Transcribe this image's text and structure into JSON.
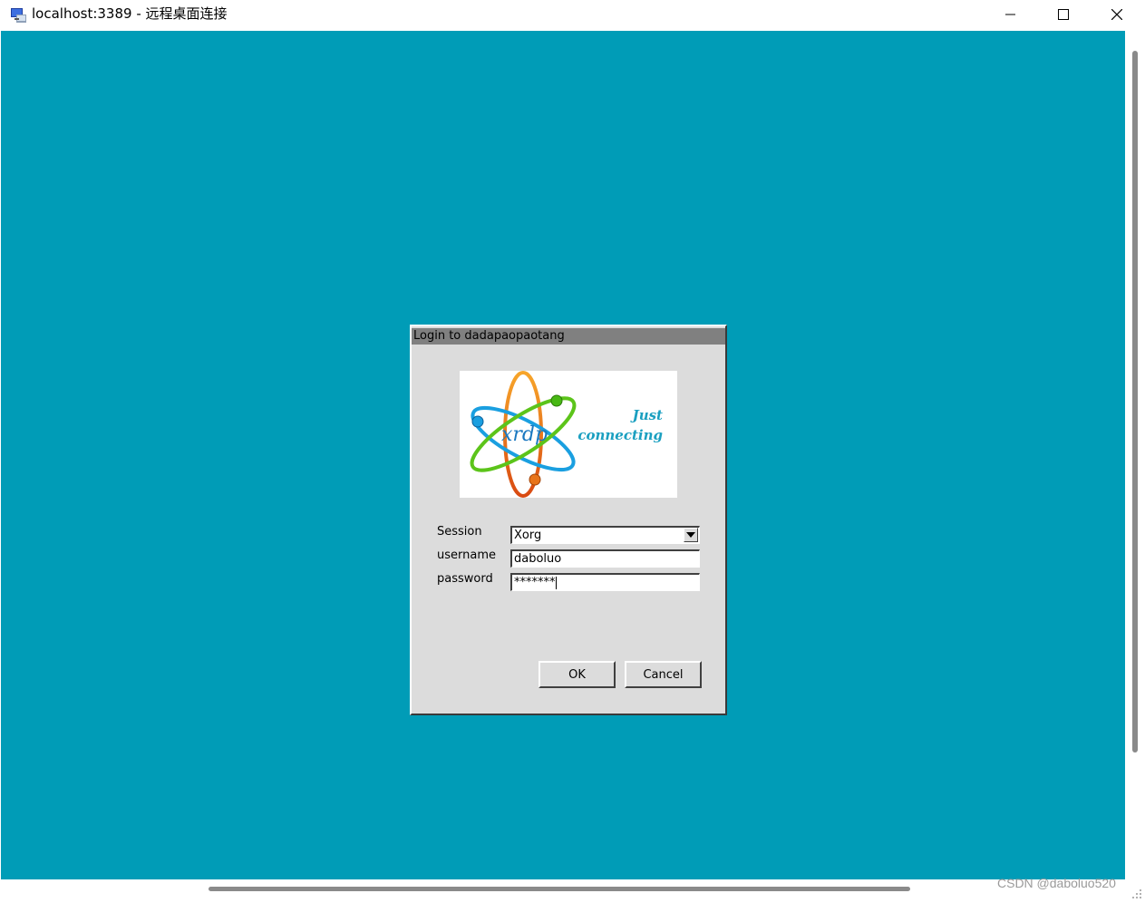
{
  "window": {
    "title": "localhost:3389 - 远程桌面连接",
    "icon": "remote-desktop-icon",
    "controls": [
      "minimize-icon",
      "maximize-icon",
      "close-icon"
    ]
  },
  "desktop": {
    "background": "#009cb7"
  },
  "dialog": {
    "title": "Login to dadapaopaotang",
    "logo": {
      "brand": "xrdp",
      "tagline_1": "Just",
      "tagline_2": "connecting"
    },
    "fields": {
      "session": {
        "label": "Session",
        "value": "Xorg"
      },
      "username": {
        "label": "username",
        "value": "daboluo"
      },
      "password": {
        "label": "password",
        "value": "*******"
      }
    },
    "buttons": {
      "ok": "OK",
      "cancel": "Cancel"
    }
  },
  "watermark": "CSDN @daboluo520"
}
